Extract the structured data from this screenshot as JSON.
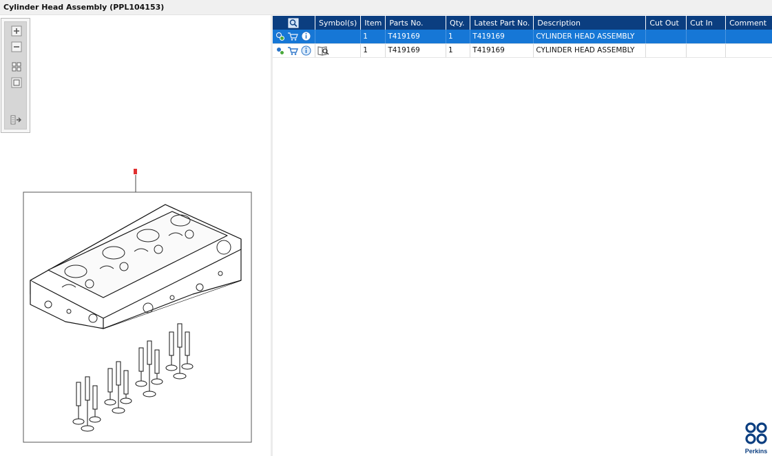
{
  "window": {
    "title": "Cylinder Head Assembly (PPL104153)"
  },
  "viewer_toolbar": {
    "buttons": [
      {
        "name": "zoom-in-icon"
      },
      {
        "name": "zoom-out-icon"
      },
      {
        "name": "fit-page-icon"
      },
      {
        "name": "actual-size-icon"
      },
      {
        "name": "toggle-panel-icon"
      }
    ]
  },
  "drawing": {
    "callout": "1"
  },
  "parts_table": {
    "columns": {
      "symbols": "Symbol(s)",
      "item": "Item",
      "parts_no": "Parts No.",
      "qty": "Qty.",
      "latest_part_no": "Latest Part No.",
      "description": "Description",
      "cut_out": "Cut Out",
      "cut_in": "Cut In",
      "comment": "Comment"
    },
    "rows": [
      {
        "selected": true,
        "item": "1",
        "parts_no": "T419169",
        "qty": "1",
        "latest_part_no": "T419169",
        "description": "CYLINDER HEAD ASSEMBLY",
        "cut_out": "",
        "cut_in": "",
        "comment": ""
      },
      {
        "selected": false,
        "item": "1",
        "parts_no": "T419169",
        "qty": "1",
        "latest_part_no": "T419169",
        "description": "CYLINDER HEAD ASSEMBLY",
        "cut_out": "",
        "cut_in": "",
        "comment": ""
      }
    ]
  },
  "brand": {
    "name": "Perkins",
    "color": "#0b3e80"
  },
  "colors": {
    "header": "#0b3e80",
    "selected_row": "#1677d6"
  }
}
